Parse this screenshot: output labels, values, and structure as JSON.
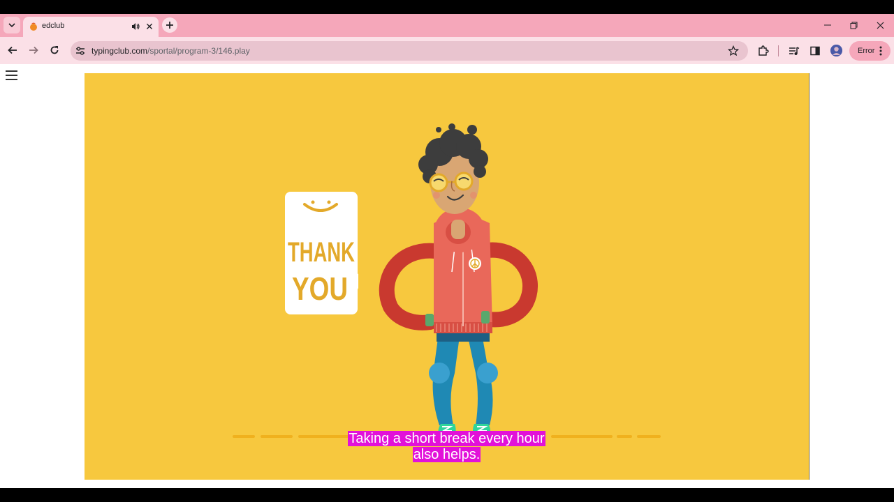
{
  "browser": {
    "tab_title": "edclub",
    "url_domain": "typingclub.com",
    "url_path": "/sportal/program-3/146.play",
    "error_label": "Error",
    "icons": [
      "tab-search-icon",
      "favicon",
      "audio-icon",
      "close-icon",
      "plus-icon",
      "minimize-icon",
      "restore-icon",
      "close-window-icon",
      "back-icon",
      "forward-icon",
      "reload-icon",
      "site-settings-icon",
      "star-icon",
      "extensions-icon",
      "media-control-icon",
      "side-panel-icon",
      "profile-avatar",
      "more-icon"
    ]
  },
  "lesson": {
    "bubble_lines": [
      "THANK",
      "YOU"
    ],
    "caption_lines": [
      "Taking a short break every hour",
      "also helps."
    ],
    "colors": {
      "stage": "#f7c83e",
      "caption_bg": "#e211d9",
      "hoodie": "#e9685a",
      "jeans": "#1f89b4"
    }
  }
}
